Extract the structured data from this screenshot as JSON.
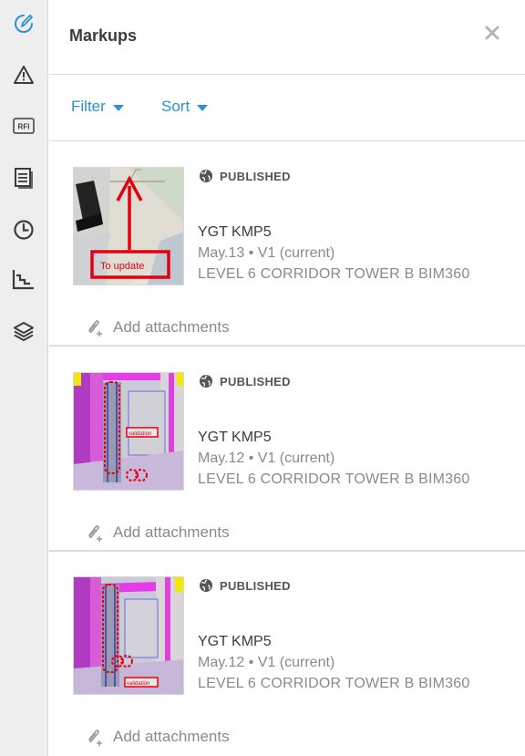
{
  "sidebar": {
    "items": [
      {
        "icon": "markup-pen-icon"
      },
      {
        "icon": "warning-triangle-icon"
      },
      {
        "icon": "rfi-icon",
        "label": "RFI"
      },
      {
        "icon": "sheets-list-icon"
      },
      {
        "icon": "clock-icon"
      },
      {
        "icon": "level-chart-icon"
      },
      {
        "icon": "layers-icon"
      }
    ],
    "active_color": "#2d8fd5"
  },
  "panel": {
    "title": "Markups",
    "close_icon": "close-icon"
  },
  "toolbar": {
    "filter_label": "Filter",
    "sort_label": "Sort"
  },
  "markups": [
    {
      "status": "PUBLISHED",
      "name": "YGT KMP5",
      "meta": "May.13 • V1 (current)",
      "location": "LEVEL 6 CORRIDOR TOWER B BIM360",
      "attach_label": "Add attachments",
      "thumb_text": "To update"
    },
    {
      "status": "PUBLISHED",
      "name": "YGT KMP5",
      "meta": "May.12 • V1 (current)",
      "location": "LEVEL 6 CORRIDOR TOWER B BIM360",
      "attach_label": "Add attachments",
      "thumb_text": "validation"
    },
    {
      "status": "PUBLISHED",
      "name": "YGT KMP5",
      "meta": "May.12 • V1 (current)",
      "location": "LEVEL 6 CORRIDOR TOWER B BIM360",
      "attach_label": "Add attachments",
      "thumb_text": "validation"
    }
  ],
  "colors": {
    "accent": "#2d8fd5",
    "markup_red": "#e3000f",
    "text": "#3c3c3c",
    "muted": "#8a8a8a"
  }
}
